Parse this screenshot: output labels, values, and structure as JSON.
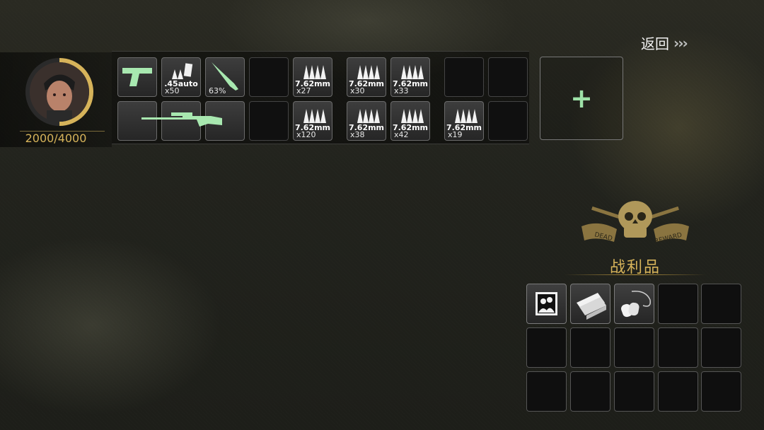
{
  "header": {
    "back_label": "返回",
    "back_arrows": [
      "›",
      "›",
      "›"
    ]
  },
  "player": {
    "hp_text": "2000/4000",
    "hp_fraction": 0.5
  },
  "inventory": {
    "pistol_icon": "pistol-icon",
    "ammo_45": {
      "caliber": ".45auto",
      "count": "x50"
    },
    "knife": {
      "durability": "63%"
    },
    "rifle_icon": "sniper-rifle-icon",
    "ammo_slots": [
      {
        "caliber": "7.62mm",
        "count": "x27"
      },
      {
        "caliber": "7.62mm",
        "count": "x120"
      },
      {
        "caliber": "7.62mm",
        "count": "x30"
      },
      {
        "caliber": "7.62mm",
        "count": "x33"
      },
      {
        "caliber": "7.62mm",
        "count": "x38"
      },
      {
        "caliber": "7.62mm",
        "count": "x42"
      },
      {
        "caliber": "7.62mm",
        "count": "x19"
      }
    ]
  },
  "add_button": {
    "label": "+"
  },
  "spoils": {
    "title": "战利品",
    "emblem_icon": "skull-crossed-guns-emblem",
    "emblem_text": [
      "DEAD",
      "REWARD"
    ],
    "items": [
      "photo-icon",
      "papers-icon",
      "dog-tag-icon"
    ]
  },
  "colors": {
    "accent_gold": "#d6b35a",
    "accent_green": "#9ee2a8"
  }
}
